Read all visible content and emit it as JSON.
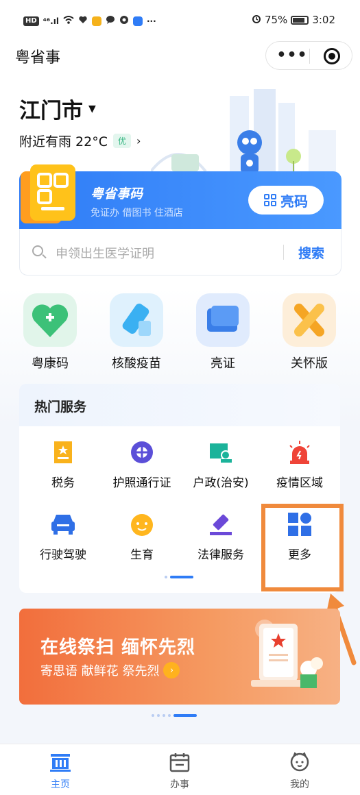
{
  "status_bar": {
    "network": "HD",
    "signal": "⁴⁶.ıl",
    "overflow": "···",
    "battery": "75%",
    "time": "3:02"
  },
  "app": {
    "title": "粤省事"
  },
  "location": {
    "city": "江门市",
    "weather": "附近有雨 22°C",
    "air_quality": "优"
  },
  "code_card": {
    "title": "粤省事码",
    "subtitle": "免证办 借图书 住酒店",
    "button_label": "亮码"
  },
  "search": {
    "placeholder": "申领出生医学证明",
    "button_label": "搜索"
  },
  "quick_actions": [
    {
      "label": "粤康码",
      "icon": "health-code-icon"
    },
    {
      "label": "核酸疫苗",
      "icon": "vaccine-icon"
    },
    {
      "label": "亮证",
      "icon": "certificate-icon"
    },
    {
      "label": "关怀版",
      "icon": "care-ribbon-icon"
    }
  ],
  "hot_services": {
    "title": "热门服务",
    "items": [
      {
        "label": "税务",
        "icon": "tax-icon"
      },
      {
        "label": "护照通行证",
        "icon": "passport-icon"
      },
      {
        "label": "户政(治安)",
        "icon": "household-icon"
      },
      {
        "label": "疫情区域",
        "icon": "alarm-icon"
      },
      {
        "label": "行驶驾驶",
        "icon": "car-icon"
      },
      {
        "label": "生育",
        "icon": "baby-icon"
      },
      {
        "label": "法律服务",
        "icon": "gavel-icon"
      },
      {
        "label": "更多",
        "icon": "grid-more-icon"
      }
    ]
  },
  "banner": {
    "title": "在线祭扫 缅怀先烈",
    "subtitle": "寄思语 献鲜花 祭先烈"
  },
  "tabbar": {
    "items": [
      {
        "label": "主页",
        "icon": "home-icon",
        "active": true
      },
      {
        "label": "办事",
        "icon": "calendar-icon",
        "active": false
      },
      {
        "label": "我的",
        "icon": "profile-icon",
        "active": false
      }
    ]
  },
  "colors": {
    "primary": "#2f7cf6",
    "highlight": "#f08a3c",
    "banner": "#f26e3c"
  }
}
